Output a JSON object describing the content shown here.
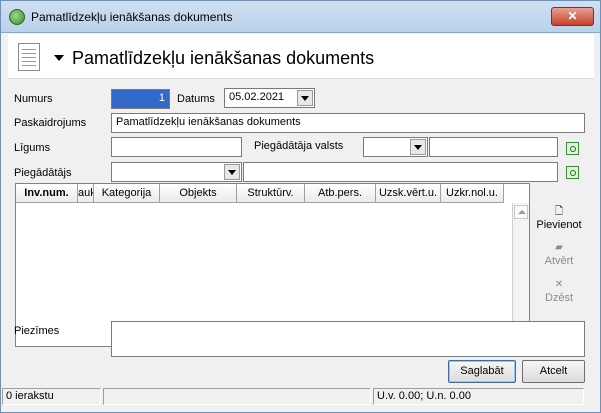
{
  "window": {
    "title": "Pamatlīdzekļu ienākšanas dokuments",
    "close_label": "✕"
  },
  "header": {
    "title": "Pamatlīdzekļu ienākšanas dokuments"
  },
  "form": {
    "numurs_label": "Numurs",
    "numurs_value": "1",
    "datums_label": "Datums",
    "datums_value": "05.02.2021",
    "paskaidrojums_label": "Paskaidrojums",
    "paskaidrojums_value": "Pamatlīdzekļu ienākšanas dokuments",
    "ligums_label": "Līgums",
    "ligums_value": "",
    "piegadataja_valsts_label": "Piegādātāja valsts",
    "piegadataja_valsts_value": "",
    "piegadataja_valsts_name": "",
    "piegadatajs_label": "Piegādātājs",
    "piegadatajs_value": "",
    "piegadatajs_name": ""
  },
  "table": {
    "columns": [
      "Inv.num.",
      "auk",
      "Kategorija",
      "Objekts",
      "Struktūrv.",
      "Atb.pers.",
      "Uzsk.vērt.u.",
      "Uzkr.nol.u."
    ],
    "rows": []
  },
  "side_actions": {
    "add_label": "Pievienot",
    "open_label": "Atvērt",
    "delete_label": "Dzēst"
  },
  "notes": {
    "label": "Piezīmes",
    "value": ""
  },
  "buttons": {
    "save_label": "Saglabāt",
    "cancel_label": "Atcelt"
  },
  "status": {
    "records": "0 ierakstu",
    "middle": "",
    "totals": "U.v. 0.00; U.n. 0.00"
  },
  "colors": {
    "selection": "#3369c8",
    "titlebar": "#b9d1ea",
    "close": "#c7412a"
  }
}
